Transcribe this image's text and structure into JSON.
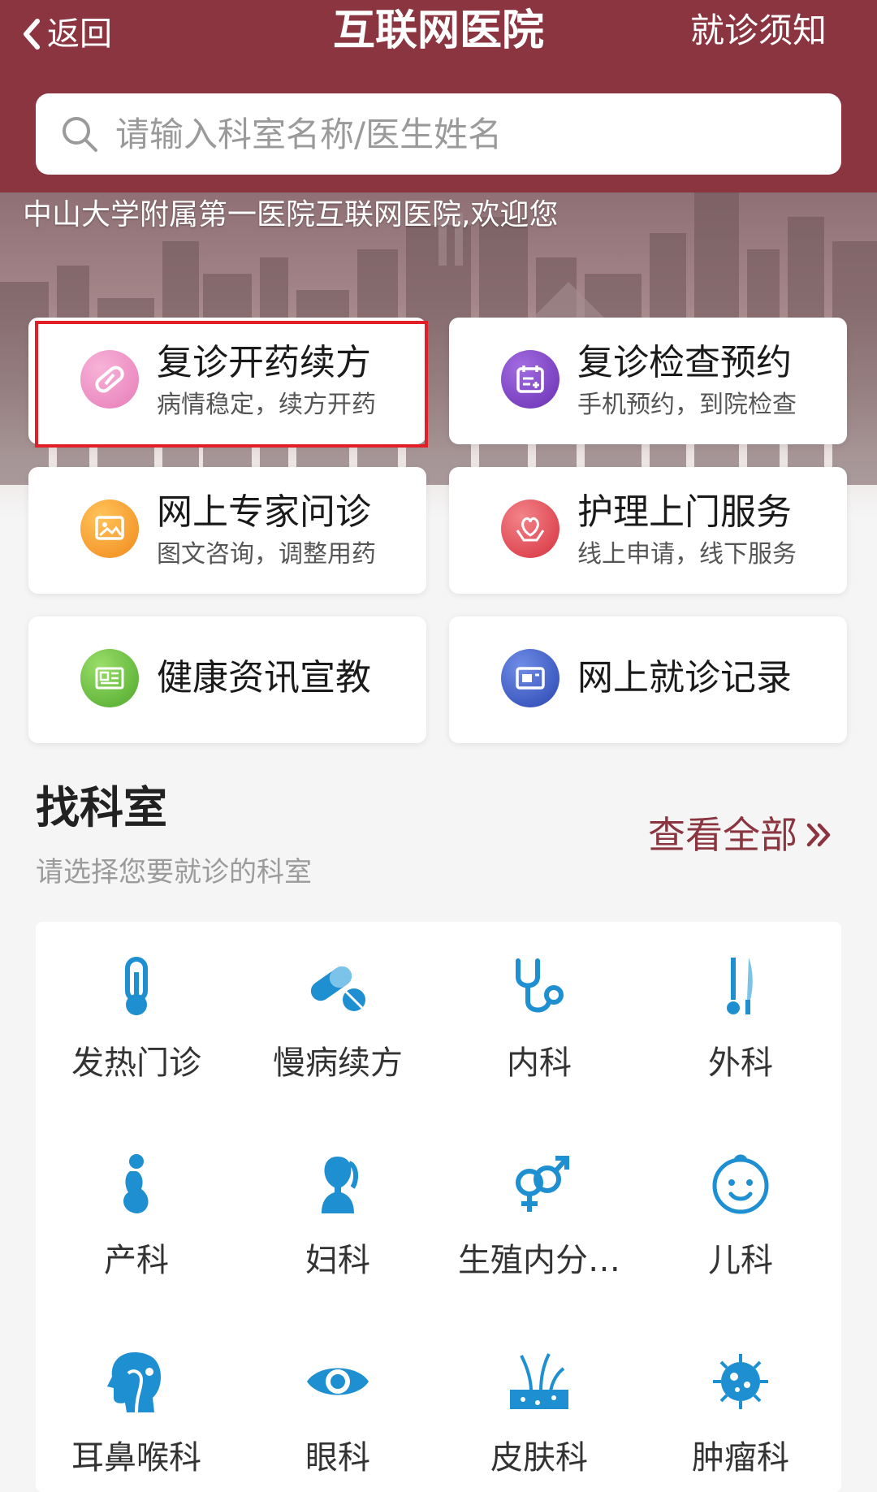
{
  "header": {
    "back_label": "返回",
    "title": "互联网医院",
    "notice_label": "就诊须知",
    "bg_color": "#8b3540"
  },
  "search": {
    "placeholder": "请输入科室名称/医生姓名"
  },
  "banner": {
    "welcome": "中山大学附属第一医院互联网医院,欢迎您"
  },
  "services": [
    {
      "title": "复诊开药续方",
      "subtitle": "病情稳定，续方开药",
      "icon": "pill-icon",
      "color": "#e77cb8",
      "highlighted": true
    },
    {
      "title": "复诊检查预约",
      "subtitle": "手机预约，到院检查",
      "icon": "calendar-icon",
      "color": "#7a3fc4"
    },
    {
      "title": "网上专家问诊",
      "subtitle": "图文咨询，调整用药",
      "icon": "picture-chat-icon",
      "color": "#f59a26"
    },
    {
      "title": "护理上门服务",
      "subtitle": "线上申请，线下服务",
      "icon": "care-hands-icon",
      "color": "#e0454e"
    },
    {
      "title": "健康资讯宣教",
      "icon": "news-icon",
      "color": "#62b83a"
    },
    {
      "title": "网上就诊记录",
      "icon": "record-icon",
      "color": "#3457c2"
    }
  ],
  "departments_section": {
    "title": "找科室",
    "subtitle": "请选择您要就诊的科室",
    "view_all": "查看全部",
    "accent_color": "#1e8fd0"
  },
  "departments": [
    {
      "label": "发热门诊",
      "icon": "thermometer-icon"
    },
    {
      "label": "慢病续方",
      "icon": "capsule-tablet-icon"
    },
    {
      "label": "内科",
      "icon": "stethoscope-icon"
    },
    {
      "label": "外科",
      "icon": "scalpel-icon"
    },
    {
      "label": "产科",
      "icon": "pregnant-icon"
    },
    {
      "label": "妇科",
      "icon": "woman-icon"
    },
    {
      "label": "生殖内分…",
      "icon": "gender-icon"
    },
    {
      "label": "儿科",
      "icon": "baby-face-icon"
    },
    {
      "label": "耳鼻喉科",
      "icon": "ent-head-icon"
    },
    {
      "label": "眼科",
      "icon": "eye-icon"
    },
    {
      "label": "皮肤科",
      "icon": "skin-hair-icon"
    },
    {
      "label": "肿瘤科",
      "icon": "tumor-cell-icon"
    }
  ]
}
